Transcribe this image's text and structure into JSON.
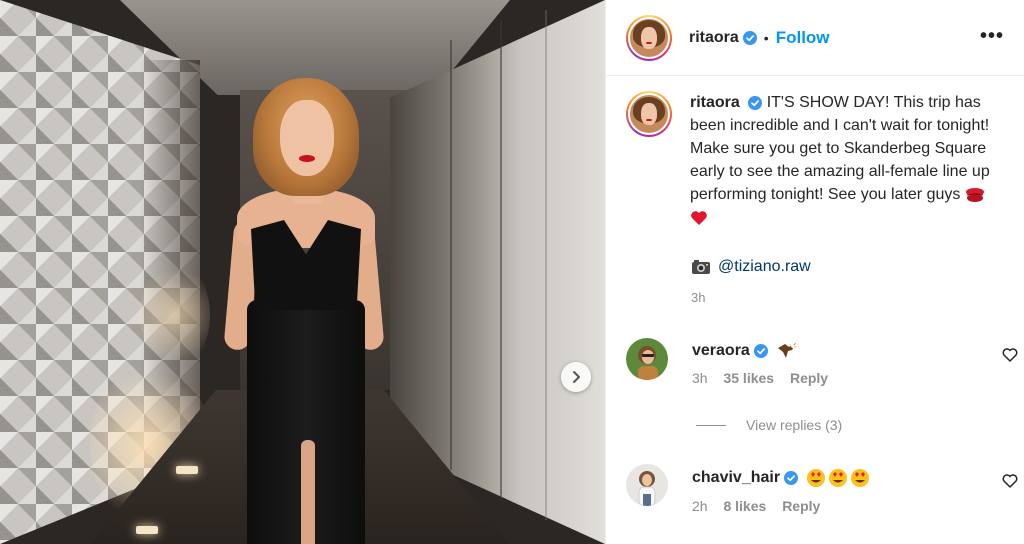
{
  "post": {
    "username": "ritaora",
    "follow_label": "Follow",
    "separator": "•",
    "more_label": "•••",
    "caption": "IT'S SHOW DAY! This trip has been incredible and I can't wait for tonight! Make sure you get to Skanderbeg Square early to see the amazing all-female line up performing tonight! See you later guys",
    "caption_emojis": [
      "kiss-mark",
      "red-heart"
    ],
    "photo_credit_icon": "camera-icon",
    "photo_credit": "@tiziano.raw",
    "time": "3h"
  },
  "comments": [
    {
      "username": "veraora",
      "verified": true,
      "emoji": "eagle",
      "time": "3h",
      "likes": "35 likes",
      "reply_label": "Reply"
    },
    {
      "username": "chaviv_hair",
      "verified": true,
      "emoji": "heart-eyes x3",
      "time": "2h",
      "likes": "8 likes",
      "reply_label": "Reply"
    }
  ],
  "view_replies": "View replies (3)",
  "colors": {
    "accent": "#0095f6",
    "verified": "#3897f0",
    "link": "#00376b",
    "muted": "#8e8e8e"
  }
}
